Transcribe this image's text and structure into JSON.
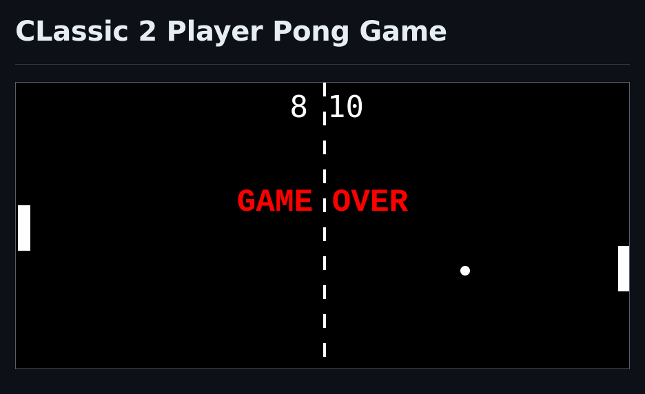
{
  "page": {
    "title": "CLassic 2 Player Pong Game"
  },
  "game": {
    "scores": {
      "left": "8",
      "right": "10"
    },
    "status_text": "GAME OVER",
    "colors": {
      "background": "#000000",
      "foreground": "#ffffff",
      "status": "#ff0000",
      "page_background": "#0d1117",
      "title": "#e6edf3"
    }
  }
}
